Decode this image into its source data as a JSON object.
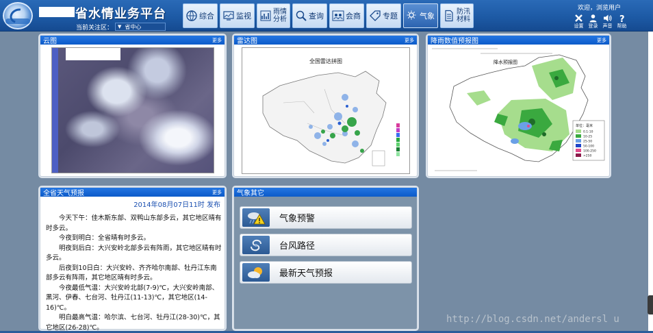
{
  "header": {
    "app_title": "省水情业务平台",
    "focus_label": "当前关注区：",
    "focus_value": "省中心",
    "welcome": "欢迎，浏览用户",
    "tabs": [
      {
        "label": "综合",
        "icon": "globe-icon",
        "active": false
      },
      {
        "label": "监视",
        "icon": "monitor-chart-icon",
        "active": false
      },
      {
        "label_line1": "雨情",
        "label_line2": "分析",
        "icon": "bar-chart-icon",
        "active": false
      },
      {
        "label": "查询",
        "icon": "magnifier-icon",
        "active": false
      },
      {
        "label": "会商",
        "icon": "meeting-icon",
        "active": false
      },
      {
        "label": "专题",
        "icon": "tag-icon",
        "active": false
      },
      {
        "label": "气象",
        "icon": "weather-icon",
        "active": true
      },
      {
        "label_line1": "防汛",
        "label_line2": "材料",
        "icon": "document-icon",
        "active": false
      }
    ],
    "tools": [
      {
        "label": "设置",
        "icon": "settings-icon"
      },
      {
        "label": "登录",
        "icon": "user-icon"
      },
      {
        "label": "声音",
        "icon": "speaker-icon"
      },
      {
        "label": "帮助",
        "icon": "help-icon"
      }
    ]
  },
  "panels": {
    "cloud": {
      "title": "云图",
      "more": "更多"
    },
    "radar": {
      "title": "雷达图",
      "more": "更多",
      "map_title": "全国雷达拼图"
    },
    "rain": {
      "title": "降雨数值预报图",
      "more": "更多",
      "map_title": "降水预报图",
      "legend_title": "单位：毫米",
      "legend": [
        "0.1-10",
        "10-25",
        "25-50",
        "50-100",
        "100-250",
        ">250"
      ]
    },
    "forecast": {
      "title": "全省天气预报",
      "more": "更多",
      "published": "2014年08月07日11时 发布",
      "paragraphs": [
        "今天下午：佳木斯东部、双鸭山东部多云，其它地区晴有时多云。",
        "今夜到明白：全省晴有时多云。",
        "明夜到后白：大兴安岭北部多云有阵雨，其它地区晴有时多云。",
        "后夜到10日白：大兴安岭、齐齐哈尔南部、牡丹江东南部多云有阵雨，其它地区晴有时多云。",
        "今夜最低气温：大兴安岭北部(7-9)℃，大兴安岭南部、黑河、伊春、七台河、牡丹江(11-13)℃，其它地区(14-16)℃。",
        "明白最高气温：哈尔滨、七台河、牡丹江(28-30)℃，其它地区(26-28)℃。"
      ]
    },
    "weather_other": {
      "title": "气象其它",
      "buttons": [
        {
          "label": "气象预警",
          "icon": "warning-icon"
        },
        {
          "label": "台风路径",
          "icon": "typhoon-icon"
        },
        {
          "label": "最新天气预报",
          "icon": "sun-cloud-icon"
        }
      ]
    }
  },
  "watermark": "http://blog.csdn.net/andersl u",
  "colors": {
    "header": "#1d5aa5",
    "panel_head": "#1468d6",
    "background": "#758ba3",
    "active_tab": "#2c64b1"
  }
}
